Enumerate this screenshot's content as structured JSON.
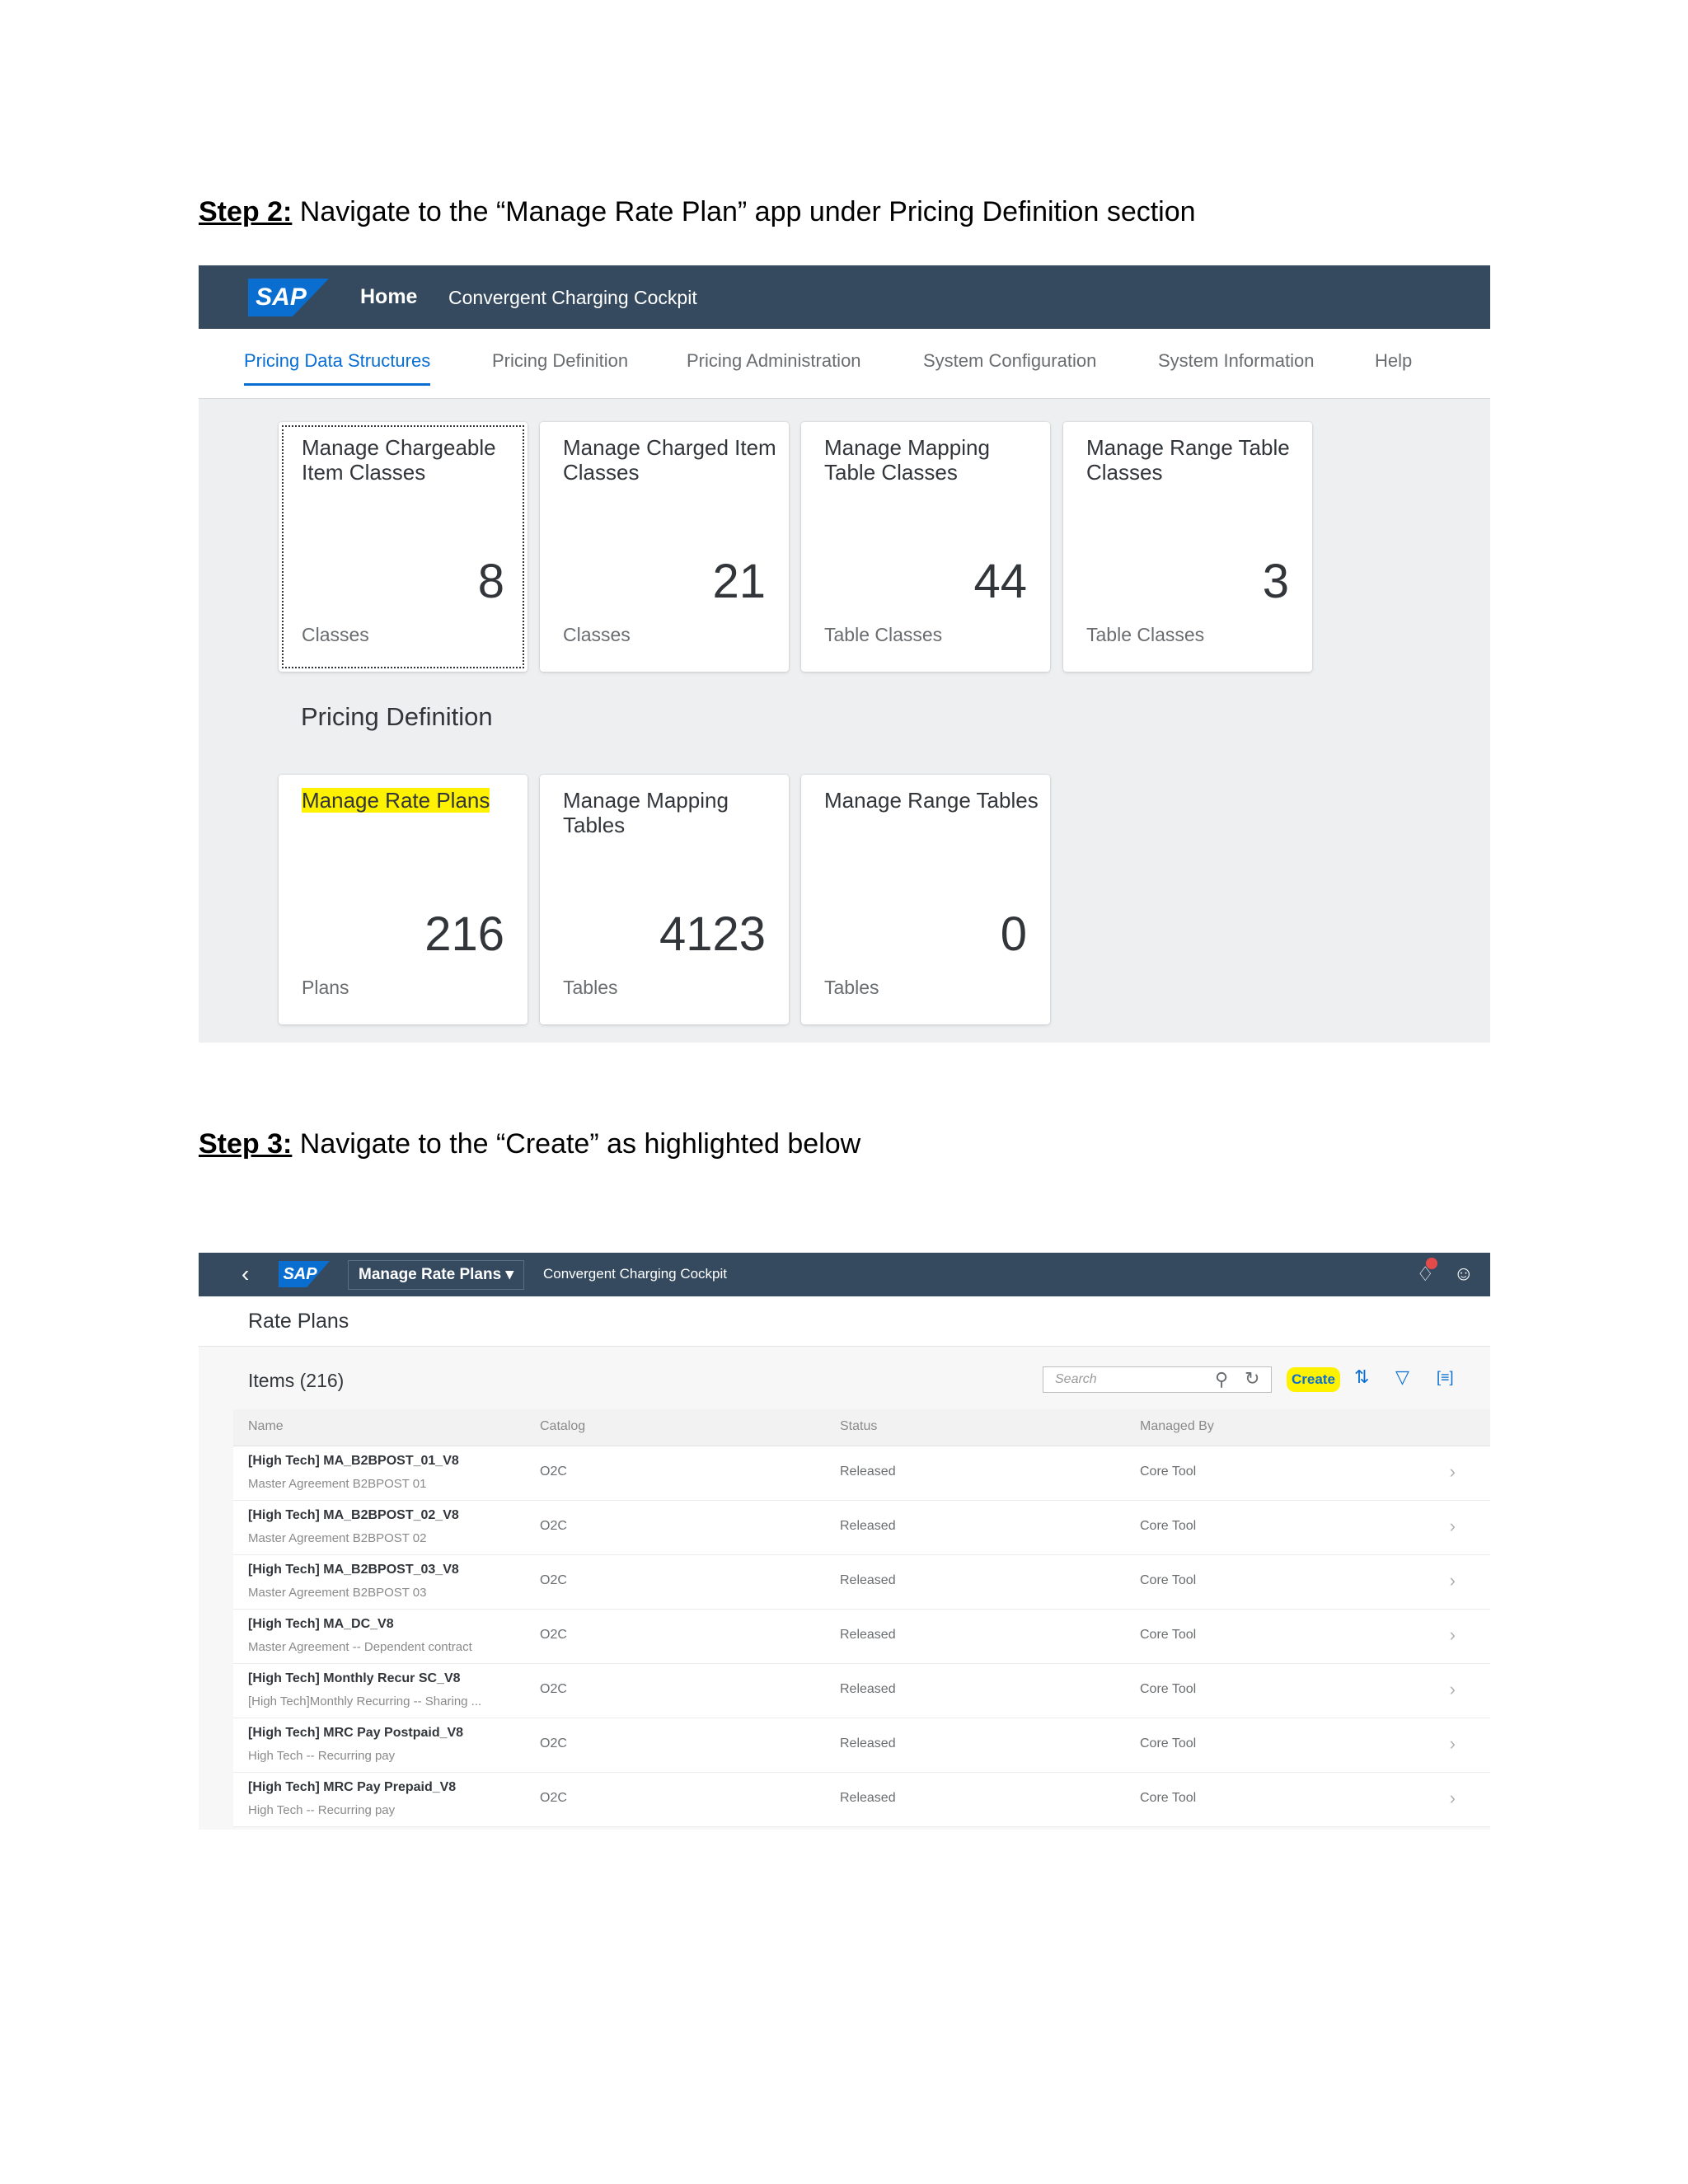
{
  "step2": {
    "label": "Step 2:",
    "text": " Navigate to the “Manage Rate Plan” app under Pricing Definition section"
  },
  "step3": {
    "label": "Step 3:",
    "text": " Navigate to the “Create” as highlighted below"
  },
  "screen1": {
    "logo": "SAP",
    "home": "Home",
    "app_title": "Convergent Charging Cockpit",
    "tabs": [
      "Pricing Data Structures",
      "Pricing Definition",
      "Pricing Administration",
      "System Configuration",
      "System Information",
      "Help"
    ],
    "row1_tiles": [
      {
        "title": "Manage Chargeable Item Classes",
        "number": "8",
        "unit": "Classes"
      },
      {
        "title": "Manage Charged Item Classes",
        "number": "21",
        "unit": "Classes"
      },
      {
        "title": "Manage Mapping Table Classes",
        "number": "44",
        "unit": "Table Classes"
      },
      {
        "title": "Manage Range Table Classes",
        "number": "3",
        "unit": "Table Classes"
      }
    ],
    "section_title": "Pricing Definition",
    "row2_tiles": [
      {
        "title": "Manage Rate Plans",
        "number": "216",
        "unit": "Plans"
      },
      {
        "title": "Manage Mapping Tables",
        "number": "4123",
        "unit": "Tables"
      },
      {
        "title": "Manage Range Tables",
        "number": "0",
        "unit": "Tables"
      }
    ],
    "highlight_color": "#fff200"
  },
  "screen2": {
    "back_icon": "chevron-left-icon",
    "logo": "SAP",
    "app_menu": "Manage Rate Plans ▾",
    "app_subtitle": "Convergent Charging Cockpit",
    "page_title": "Rate Plans",
    "items_label": "Items (216)",
    "search_placeholder": "Search",
    "create_label": "Create",
    "columns": [
      "Name",
      "Catalog",
      "Status",
      "Managed By"
    ],
    "rows": [
      {
        "name": "[High Tech] MA_B2BPOST_01_V8",
        "desc": "Master Agreement B2BPOST 01",
        "catalog": "O2C",
        "status": "Released",
        "managed_by": "Core Tool"
      },
      {
        "name": "[High Tech] MA_B2BPOST_02_V8",
        "desc": "Master Agreement B2BPOST 02",
        "catalog": "O2C",
        "status": "Released",
        "managed_by": "Core Tool"
      },
      {
        "name": "[High Tech] MA_B2BPOST_03_V8",
        "desc": "Master Agreement B2BPOST 03",
        "catalog": "O2C",
        "status": "Released",
        "managed_by": "Core Tool"
      },
      {
        "name": "[High Tech] MA_DC_V8",
        "desc": "Master Agreement -- Dependent contract",
        "catalog": "O2C",
        "status": "Released",
        "managed_by": "Core Tool"
      },
      {
        "name": "[High Tech] Monthly Recur SC_V8",
        "desc": "[High Tech]Monthly Recurring -- Sharing ...",
        "catalog": "O2C",
        "status": "Released",
        "managed_by": "Core Tool"
      },
      {
        "name": "[High Tech] MRC Pay Postpaid_V8",
        "desc": "High Tech -- Recurring pay",
        "catalog": "O2C",
        "status": "Released",
        "managed_by": "Core Tool"
      },
      {
        "name": "[High Tech] MRC Pay Prepaid_V8",
        "desc": "High Tech -- Recurring pay",
        "catalog": "O2C",
        "status": "Released",
        "managed_by": "Core Tool"
      }
    ]
  }
}
